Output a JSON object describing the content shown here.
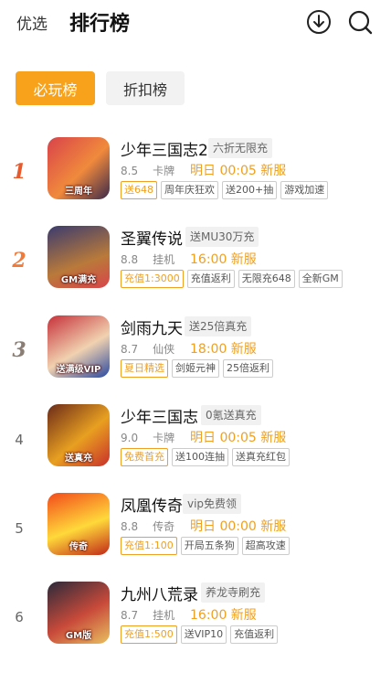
{
  "header": {
    "tab_youxuan": "优选",
    "tab_paihang": "排行榜"
  },
  "segments": {
    "active": "必玩榜",
    "inactive": "折扣榜"
  },
  "colors": {
    "accent": "#f7a21a",
    "time": "#f0a020"
  },
  "games": [
    {
      "rank": "1",
      "name": "少年三国志2",
      "tag": "六折无限充",
      "rating": "8.5",
      "type": "卡牌",
      "time": "明日 00:05 新服",
      "icon_text": "三周年",
      "chips": [
        {
          "text": "送648",
          "hl": true
        },
        {
          "text": "周年庆狂欢",
          "hl": false
        },
        {
          "text": "送200+抽",
          "hl": false
        },
        {
          "text": "游戏加速",
          "hl": false
        }
      ]
    },
    {
      "rank": "2",
      "name": "圣翼传说",
      "tag": "送MU30万充",
      "rating": "8.8",
      "type": "挂机",
      "time": "16:00 新服",
      "icon_text": "GM满充",
      "chips": [
        {
          "text": "充值1:3000",
          "hl": true
        },
        {
          "text": "充值返利",
          "hl": false
        },
        {
          "text": "无限充648",
          "hl": false
        },
        {
          "text": "全新GM",
          "hl": false
        }
      ]
    },
    {
      "rank": "3",
      "name": "剑雨九天",
      "tag": "送25倍真充",
      "rating": "8.7",
      "type": "仙侠",
      "time": "18:00 新服",
      "icon_text": "送满级VIP",
      "chips": [
        {
          "text": "夏日精选",
          "hl": true
        },
        {
          "text": "剑姬元神",
          "hl": false
        },
        {
          "text": "25倍返利",
          "hl": false
        }
      ]
    },
    {
      "rank": "4",
      "name": "少年三国志",
      "tag": "0氪送真充",
      "rating": "9.0",
      "type": "卡牌",
      "time": "明日 00:05 新服",
      "icon_text": "送真充",
      "chips": [
        {
          "text": "免费首充",
          "hl": true
        },
        {
          "text": "送100连抽",
          "hl": false
        },
        {
          "text": "送真充红包",
          "hl": false
        }
      ]
    },
    {
      "rank": "5",
      "name": "凤凰传奇",
      "tag": "vip免费领",
      "rating": "8.8",
      "type": "传奇",
      "time": "明日 00:00 新服",
      "icon_text": "传奇",
      "chips": [
        {
          "text": "充值1:100",
          "hl": true
        },
        {
          "text": "开局五条狗",
          "hl": false
        },
        {
          "text": "超高攻速",
          "hl": false
        }
      ]
    },
    {
      "rank": "6",
      "name": "九州八荒录",
      "tag": "养龙寺刷充",
      "rating": "8.7",
      "type": "挂机",
      "time": "16:00 新服",
      "icon_text": "GM版",
      "chips": [
        {
          "text": "充值1:500",
          "hl": true
        },
        {
          "text": "送VIP10",
          "hl": false
        },
        {
          "text": "充值返利",
          "hl": false
        }
      ]
    }
  ]
}
